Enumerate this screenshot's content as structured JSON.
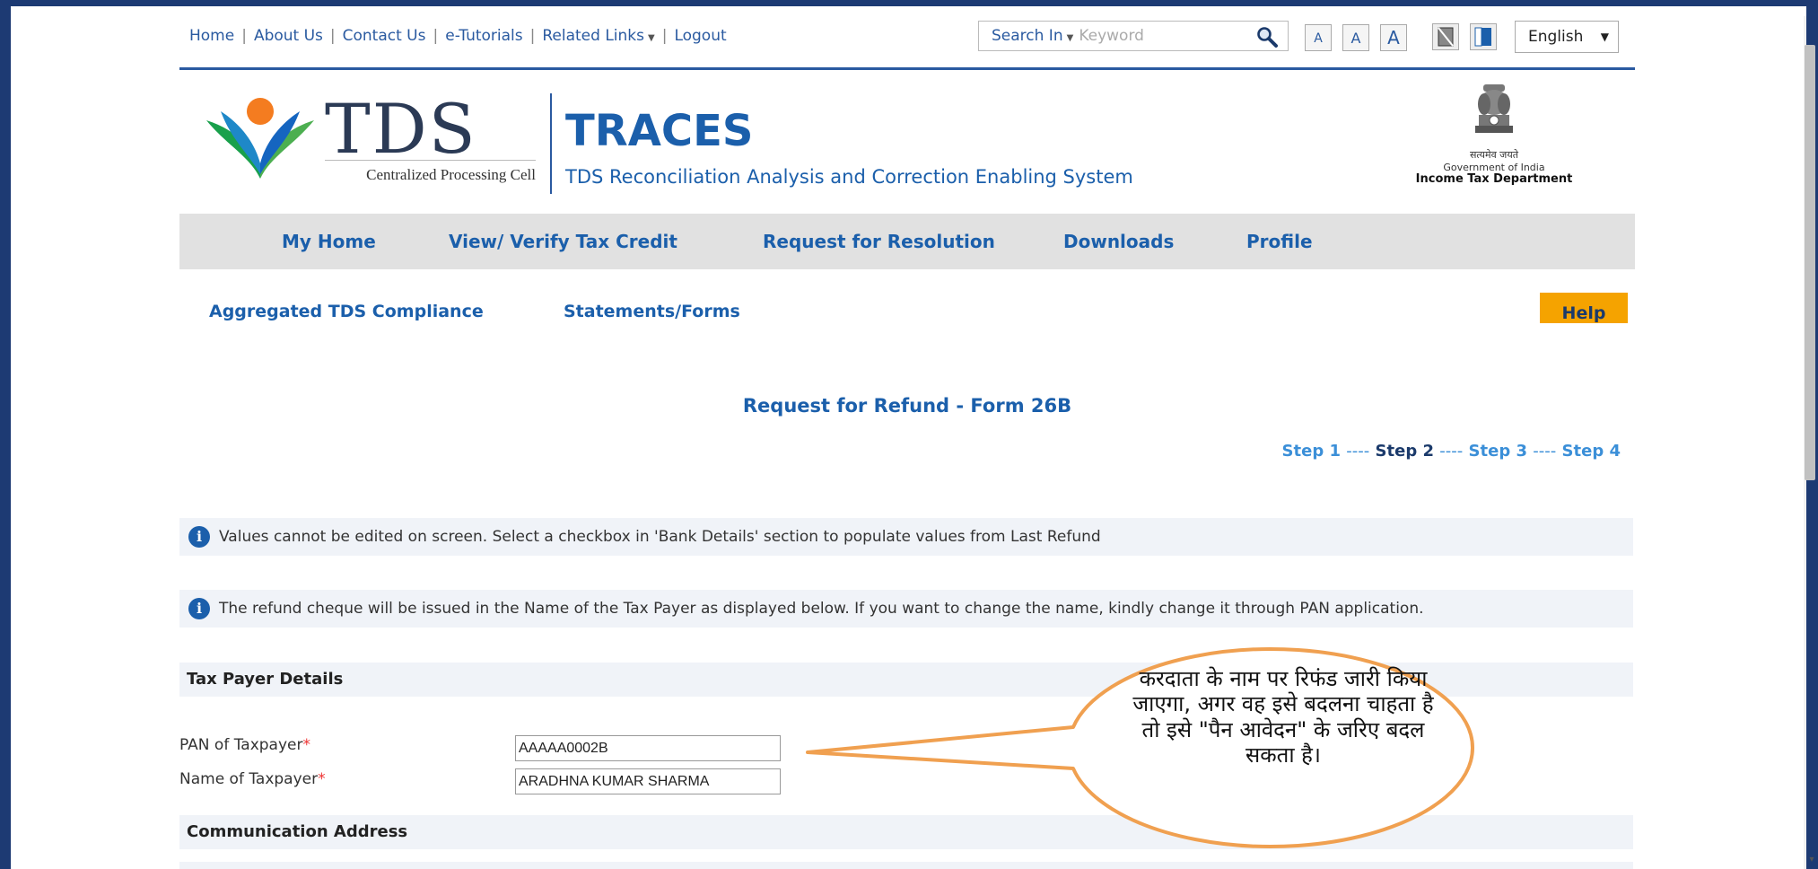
{
  "topbar": {
    "links": [
      "Home",
      "About Us",
      "Contact Us",
      "e-Tutorials",
      "Related Links",
      "Logout"
    ],
    "search_in_label": "Search In",
    "search_placeholder": "Keyword",
    "font_size_buttons": [
      "A",
      "A",
      "A"
    ],
    "language": "English"
  },
  "header": {
    "tds_wordmark": "TDS",
    "tds_subtitle": "Centralized Processing Cell",
    "app_name": "TRACES",
    "app_subtitle": "TDS Reconciliation Analysis and Correction Enabling System",
    "emblem_motto": "सत्यमेव जयते",
    "emblem_line1": "Government of India",
    "emblem_line2": "Income Tax Department"
  },
  "mainnav": [
    "My Home",
    "View/ Verify Tax Credit",
    "Request for Resolution",
    "Downloads",
    "Profile"
  ],
  "subnav": [
    "Aggregated TDS Compliance",
    "Statements/Forms"
  ],
  "help_label": "Help",
  "page": {
    "title": "Request for Refund - Form 26B",
    "steps": [
      "Step 1",
      "Step 2",
      "Step 3",
      "Step 4"
    ],
    "step_separator": "----",
    "current_step": "Step 2",
    "info1": "Values cannot be edited on screen. Select a checkbox in 'Bank Details' section to populate values from Last Refund",
    "info2": "The refund cheque will be issued in the Name of the Tax Payer as displayed below. If you want to change the name, kindly change it through PAN application."
  },
  "taxpayer": {
    "section_title": "Tax Payer Details",
    "pan_label": "PAN of Taxpayer",
    "pan_value": "AAAAA0002B",
    "name_label": "Name of Taxpayer",
    "name_value": "ARADHNA KUMAR SHARMA",
    "required_mark": "*"
  },
  "communication": {
    "section_title": "Communication Address"
  },
  "callout": {
    "text": "करदाता के नाम पर रिफंड जारी किया जाएगा, अगर वह इसे बदलना चाहता है तो इसे \"पैन आवेदन\" के जरिए बदल सकता है।"
  },
  "colors": {
    "brand_blue": "#1b5fab",
    "help_orange": "#f5a300",
    "callout_orange": "#f0a050"
  }
}
